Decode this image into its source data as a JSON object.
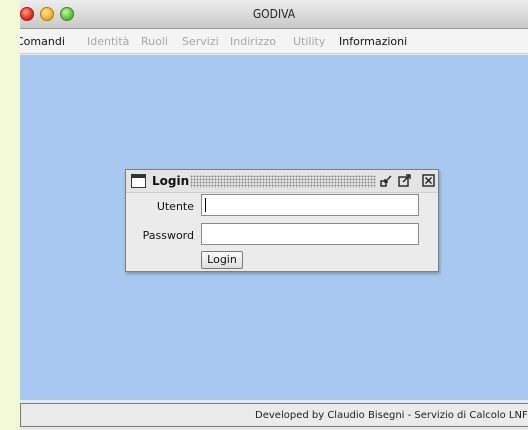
{
  "window": {
    "title": "GODIVA"
  },
  "menu": {
    "items": [
      {
        "label": "Comandi",
        "enabled": true
      },
      {
        "label": "Identità",
        "enabled": false
      },
      {
        "label": "Ruoli",
        "enabled": false
      },
      {
        "label": "Servizi",
        "enabled": false
      },
      {
        "label": "Indirizzo",
        "enabled": false
      },
      {
        "label": "Utility",
        "enabled": false
      },
      {
        "label": "Informazioni",
        "enabled": true
      }
    ]
  },
  "login": {
    "title": "Login",
    "user_label": "Utente",
    "user_value": "",
    "password_label": "Password",
    "password_value": "",
    "button_label": "Login"
  },
  "status": {
    "text": "Developed by Claudio Bisegni - Servizio di Calcolo LNF-INFN"
  },
  "colors": {
    "desktop": "#a9c8ef",
    "background": "#f3f8d6"
  },
  "icons": [
    "window-icon",
    "iconify-icon",
    "maximize-icon",
    "close-icon"
  ]
}
